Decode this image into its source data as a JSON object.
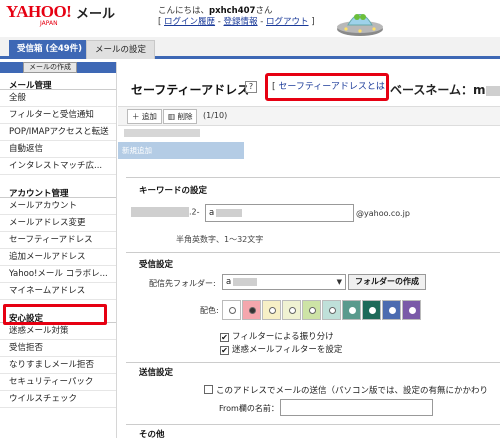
{
  "header": {
    "logo_text": "YAHOO!",
    "logo_sub": "JAPAN",
    "service": "メール",
    "greeting_prefix": "こんにちは、",
    "username": "pxhch407",
    "greeting_suffix": "さん",
    "login_history": "ログイン履歴",
    "registration": "登録情報",
    "logout": "ログアウト",
    "sep": " - "
  },
  "tabs": {
    "inbox": "受信箱 (全49件)",
    "settings": "メールの設定"
  },
  "sidebar": {
    "compose": "メールの作成",
    "sections": [
      {
        "title": "メール管理",
        "items": [
          "全般",
          "フィルターと受信通知",
          "POP/IMAPアクセスと転送",
          "自動返信",
          "インタレストマッチ広..."
        ]
      },
      {
        "title": "アカウント管理",
        "items": [
          "メールアカウント",
          "メールアドレス変更",
          "セーフティーアドレス",
          "追加メールアドレス",
          "Yahoo!メール コラボレ...",
          "マイネームアドレス"
        ]
      },
      {
        "title": "安心設定",
        "items": [
          "迷惑メール対策",
          "受信拒否",
          "なりすましメール拒否",
          "セキュリティーパック",
          "ウイルスチェック"
        ]
      }
    ]
  },
  "main": {
    "title": "セーフティーアドレス",
    "help": "?",
    "about_link": "セーフティーアドレスとは",
    "base_name_label": "ベースネーム：m",
    "toolbar": {
      "add": "＋ 追加",
      "delete": "削除",
      "page": "(1/10)"
    },
    "new_entry": "新規追加",
    "keyword_section": "キーワードの設定",
    "keyword_prefix": ".2-",
    "keyword_value": "a",
    "keyword_domain": "@yahoo.co.jp",
    "keyword_hint": "半角英数字、1～32文字",
    "receive_section": "受信設定",
    "folder_label": "配信先フォルダー:",
    "folder_value": "a",
    "create_folder": "フォルダーの作成",
    "color_label": "配色:",
    "color_swatches": [
      {
        "color": "#ffffff",
        "selected": false
      },
      {
        "color": "#f5a7ad",
        "selected": true
      },
      {
        "color": "#f7f0c6",
        "selected": false
      },
      {
        "color": "#f0f2d2",
        "selected": false
      },
      {
        "color": "#cde3a6",
        "selected": false
      },
      {
        "color": "#bfe0d9",
        "selected": false
      },
      {
        "color": "#5a9a8d",
        "selected": false
      },
      {
        "color": "#1e6a5a",
        "selected": false
      },
      {
        "color": "#4c6bb0",
        "selected": false
      },
      {
        "color": "#7a5aa8",
        "selected": false
      }
    ],
    "filter_sort": "フィルターによる振り分け",
    "spam_filter": "迷惑メールフィルターを設定",
    "send_section": "送信設定",
    "send_checkbox": "このアドレスでメールの送信（パソコン版では、設定の有無にかかわり",
    "from_label": "From欄の名前：",
    "other_section": "その他"
  }
}
